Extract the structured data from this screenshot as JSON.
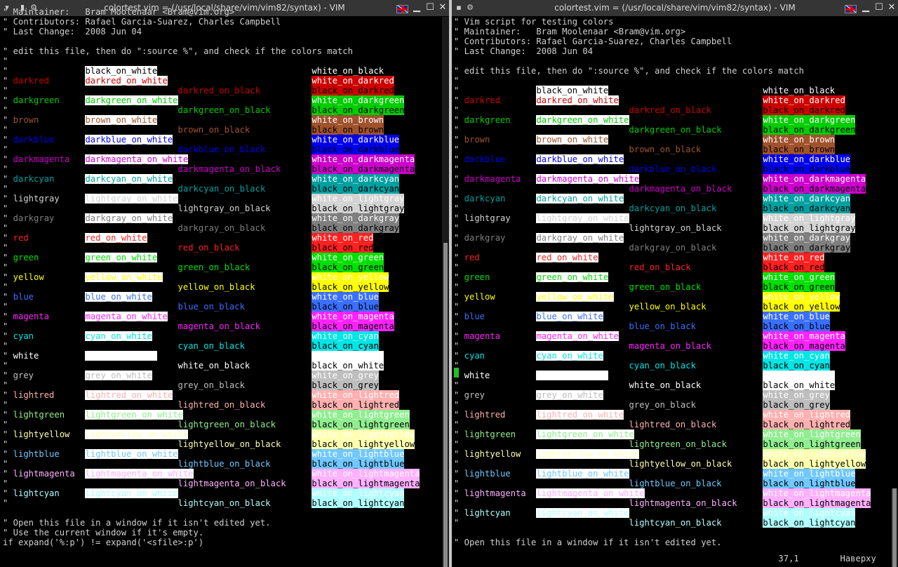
{
  "left_window": {
    "title": "colortest.vim = (/usr/local/share/vim/vim82/syntax) - VIM",
    "scroll_offset": 1,
    "header_lines": [
      "\" Maintainer:   Bram Moolenaar <Bram@vim.org>",
      "\" Contributors: Rafael Garcia-Suarez, Charles Campbell",
      "\" Last Change:  2008 Jun 04",
      "",
      "\" edit this file, then do \":source %\", and check if the colors match",
      "\"",
      "\""
    ],
    "footer_lines": [
      "",
      "\" Open this file in a window if it isn't edited yet.",
      "\" Use the current window if it's empty.",
      "if expand('%:p') != expand('<sfile>:p')"
    ]
  },
  "right_window": {
    "title": "colortest.vim = (/usr/local/share/vim/vim82/syntax) - VIM",
    "scroll_offset": 0,
    "header_lines": [
      "\" Vim script for testing colors",
      "\" Maintainer:   Bram Moolenaar <Bram@vim.org>",
      "\" Contributors: Rafael Garcia-Suarez, Charles Campbell",
      "\" Last Change:  2008 Jun 04",
      "",
      "\" edit this file, then do \":source %\", and check if the colors match",
      "\"",
      "\""
    ],
    "footer_lines": [
      "",
      "\" Open this file in a window if it isn't edited yet."
    ],
    "status_position": "37,1",
    "status_scroll": "Наверху"
  },
  "header_labels": {
    "black_on_white": "black_on_white",
    "white_on_black": "white_on_black"
  },
  "colors": [
    {
      "name": "darkred",
      "hex": "#cd0000",
      "dark_text": false
    },
    {
      "name": "darkgreen",
      "hex": "#00cd00",
      "dark_text": false
    },
    {
      "name": "brown",
      "hex": "#a0522d",
      "dark_text": false
    },
    {
      "name": "darkblue",
      "hex": "#0000ee",
      "dark_text": false
    },
    {
      "name": "darkmagenta",
      "hex": "#cd00cd",
      "dark_text": false
    },
    {
      "name": "darkcyan",
      "hex": "#00a0a0",
      "dark_text": false
    },
    {
      "name": "lightgray",
      "hex": "#d3d3d3",
      "dark_text": true
    },
    {
      "name": "darkgray",
      "hex": "#7f7f7f",
      "dark_text": true
    },
    {
      "name": "red",
      "hex": "#ff2020",
      "dark_text": false
    },
    {
      "name": "green",
      "hex": "#00e000",
      "dark_text": false
    },
    {
      "name": "yellow",
      "hex": "#ffff00",
      "dark_text": true
    },
    {
      "name": "blue",
      "hex": "#3a6fff",
      "dark_text": false
    },
    {
      "name": "magenta",
      "hex": "#ff22ff",
      "dark_text": false
    },
    {
      "name": "cyan",
      "hex": "#00e5e5",
      "dark_text": true
    },
    {
      "name": "white",
      "hex": "#ffffff",
      "dark_text": true
    },
    {
      "name": "grey",
      "hex": "#bebebe",
      "dark_text": true
    },
    {
      "name": "lightred",
      "hex": "#ffb0b0",
      "dark_text": true
    },
    {
      "name": "lightgreen",
      "hex": "#90ee90",
      "dark_text": true
    },
    {
      "name": "lightyellow",
      "hex": "#ffffb0",
      "dark_text": true
    },
    {
      "name": "lightblue",
      "hex": "#70c8ff",
      "dark_text": true
    },
    {
      "name": "lightmagenta",
      "hex": "#ffb0ff",
      "dark_text": true
    },
    {
      "name": "lightcyan",
      "hex": "#b0ffff",
      "dark_text": true
    }
  ],
  "palette": {
    "background": "#000000",
    "foreground": "#d0d0d0",
    "titlebar": "#353535",
    "cursor": "#22c022"
  }
}
